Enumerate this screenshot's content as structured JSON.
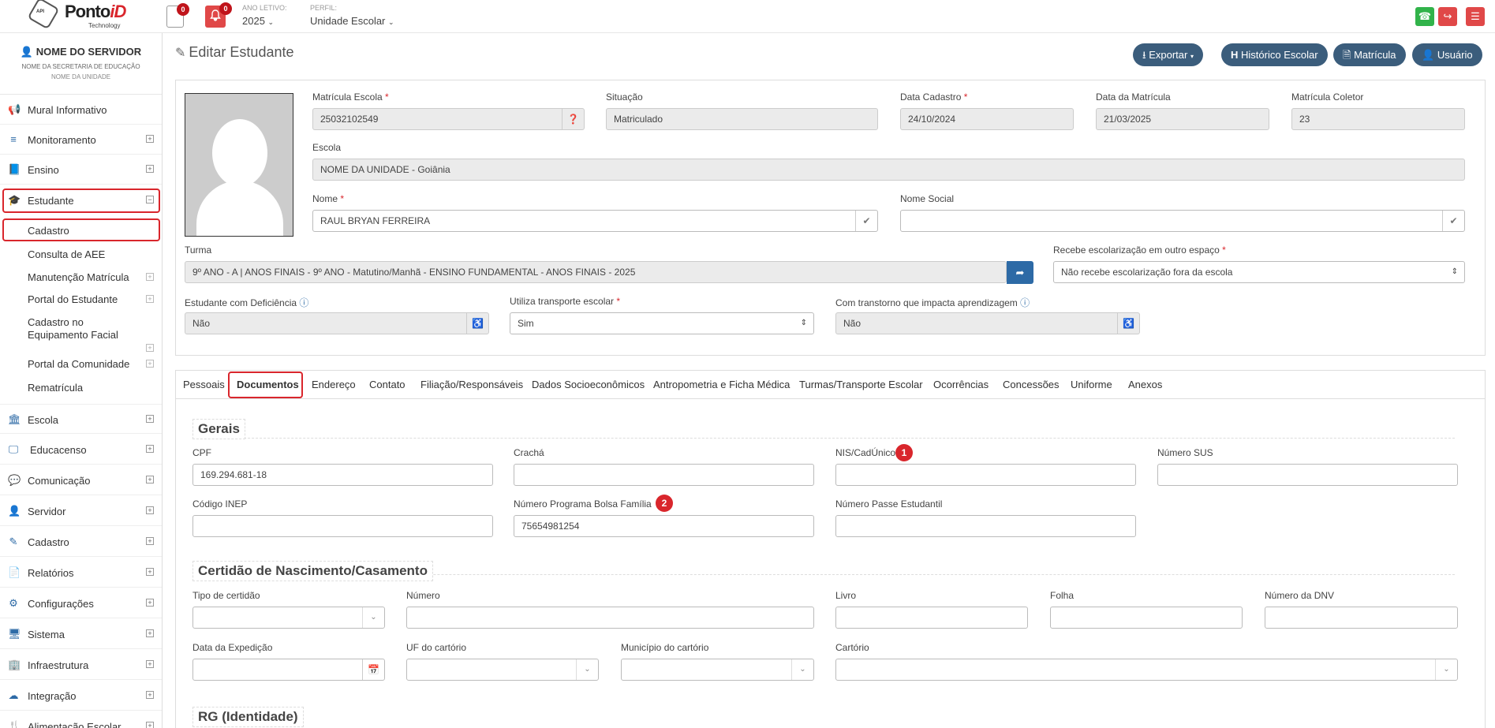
{
  "topbar": {
    "logo_brand": "Ponto",
    "logo_brand_id": "iD",
    "logo_tech": "Technology",
    "logo_hex": "API",
    "doc_badge": "0",
    "bell_badge": "0",
    "ano_label": "ANO LETIVO:",
    "ano_value": "2025",
    "perfil_label": "PERFIL:",
    "perfil_value": "Unidade Escolar"
  },
  "sidebar": {
    "user_name": "NOME DO SERVIDOR",
    "user_secretaria": "NOME DA SECRETARIA DE EDUCAÇÃO",
    "user_unidade": "NOME DA UNIDADE",
    "items": [
      {
        "label": "Mural Informativo",
        "icon": "megaphone-icon"
      },
      {
        "label": "Monitoramento",
        "icon": "sliders-icon"
      },
      {
        "label": "Ensino",
        "icon": "book-icon"
      },
      {
        "label": "Estudante",
        "icon": "graduation-cap-icon"
      },
      {
        "label": "Escola",
        "icon": "bank-icon"
      },
      {
        "label": "Educacenso",
        "icon": "monitor-icon"
      },
      {
        "label": "Comunicação",
        "icon": "chat-icon"
      },
      {
        "label": "Servidor",
        "icon": "user-icon"
      },
      {
        "label": "Cadastro",
        "icon": "edit-icon"
      },
      {
        "label": "Relatórios",
        "icon": "file-icon"
      },
      {
        "label": "Configurações",
        "icon": "gear-icon"
      },
      {
        "label": "Sistema",
        "icon": "desktop-icon"
      },
      {
        "label": "Infraestrutura",
        "icon": "building-icon"
      },
      {
        "label": "Integração",
        "icon": "cloud-icon"
      },
      {
        "label": "Alimentação Escolar",
        "icon": "food-icon"
      }
    ],
    "subitems": [
      "Cadastro",
      "Consulta de AEE",
      "Manutenção Matrícula",
      "Portal do Estudante",
      "Cadastro no Equipamento Facial",
      "Portal da Comunidade",
      "Rematrícula"
    ]
  },
  "header": {
    "title": "Editar Estudante",
    "buttons": [
      "Exportar",
      "Histórico Escolar",
      "Matrícula",
      "Usuário"
    ]
  },
  "form": {
    "matricula_escola_label": "Matrícula Escola",
    "matricula_escola": "25032102549",
    "situacao_label": "Situação",
    "situacao": "Matriculado",
    "data_cadastro_label": "Data Cadastro",
    "data_cadastro": "24/10/2024",
    "data_matricula_label": "Data da Matrícula",
    "data_matricula": "21/03/2025",
    "matricula_coletor_label": "Matrícula Coletor",
    "matricula_coletor": "23",
    "escola_label": "Escola",
    "escola": "NOME DA UNIDADE - Goiânia",
    "nome_label": "Nome",
    "nome": "RAUL BRYAN FERREIRA",
    "nome_social_label": "Nome Social",
    "nome_social": "",
    "turma_label": "Turma",
    "turma": "9º ANO - A | ANOS FINAIS - 9º ANO - Matutino/Manhã - ENSINO FUNDAMENTAL - ANOS FINAIS - 2025",
    "recebe_label": "Recebe escolarização em outro espaço",
    "recebe": "Não recebe escolarização fora da escola",
    "deficiencia_label": "Estudante com Deficiência",
    "deficiencia": "Não",
    "transporte_label": "Utiliza transporte escolar",
    "transporte": "Sim",
    "transtorno_label": "Com transtorno que impacta aprendizagem",
    "transtorno": "Não"
  },
  "tabs": [
    "Pessoais",
    "Documentos",
    "Endereço",
    "Contato",
    "Filiação/Responsáveis",
    "Dados Socioeconômicos",
    "Antropometria e Ficha Médica",
    "Turmas/Transporte Escolar",
    "Ocorrências",
    "Concessões",
    "Uniforme",
    "Anexos"
  ],
  "documentos": {
    "gerais_title": "Gerais",
    "cpf_label": "CPF",
    "cpf": "169.294.681-18",
    "cracha_label": "Crachá",
    "cracha": "",
    "nis_label": "NIS/CadÚnico",
    "nis": "",
    "sus_label": "Número SUS",
    "sus": "",
    "inep_label": "Código INEP",
    "inep": "",
    "bolsa_label": "Número Programa Bolsa Família",
    "bolsa": "75654981254",
    "passe_label": "Número Passe Estudantil",
    "passe": "",
    "certidao_title": "Certidão de Nascimento/Casamento",
    "tipo_label": "Tipo de certidão",
    "numero_label": "Número",
    "livro_label": "Livro",
    "folha_label": "Folha",
    "dnv_label": "Número da DNV",
    "expedicao_label": "Data da Expedição",
    "uf_label": "UF do cartório",
    "municipio_label": "Município  do cartório",
    "cartorio_label": "Cartório",
    "rg_title": "RG (Identidade)",
    "marker1": "1",
    "marker2": "2"
  },
  "colors": {
    "accent": "#2d6aa6",
    "header_button": "#3b5d7c",
    "highlight": "#d9262c",
    "whatsapp": "#31b34a"
  }
}
